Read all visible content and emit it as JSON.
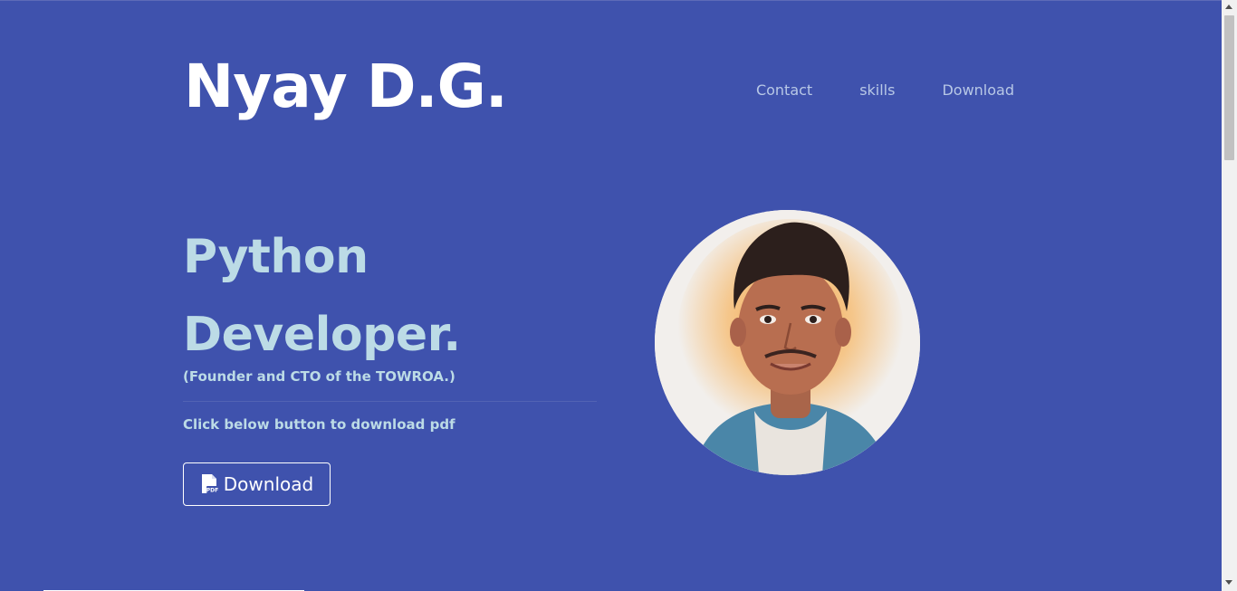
{
  "header": {
    "brand": "Nyay D.G.",
    "nav": [
      {
        "label": "Contact"
      },
      {
        "label": "skills"
      },
      {
        "label": "Download"
      }
    ]
  },
  "hero": {
    "headline_line1": "Python",
    "headline_line2": "Developer.",
    "subtitle": "(Founder and CTO of the TOWROA.)",
    "hint": "Click below button to download pdf",
    "download_label": "Download",
    "download_icon": "pdf-file-icon"
  },
  "colors": {
    "background": "#3f52ad",
    "accent_text": "#bcdbe6",
    "nav_text": "#b8c8e6"
  }
}
